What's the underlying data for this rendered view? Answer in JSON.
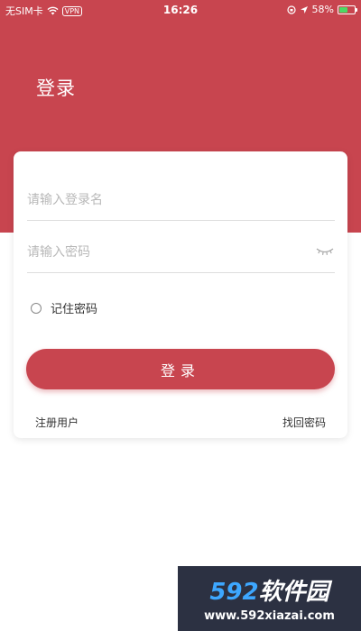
{
  "status_bar": {
    "carrier": "无SIM卡",
    "vpn": "VPN",
    "time": "16:26",
    "battery": "58%",
    "battery_level": 0.58,
    "battery_color": "#4cd964"
  },
  "header": {
    "title": "登录",
    "background_color": "#c8454f"
  },
  "form": {
    "username_placeholder": "请输入登录名",
    "password_placeholder": "请输入密码",
    "password_toggle_icon": "eye-closed-icon",
    "remember_label": "记住密码",
    "remember_checked": false,
    "login_button": "登录",
    "register_link": "注册用户",
    "forgot_link": "找回密码"
  },
  "watermark": {
    "logo_number": "592",
    "logo_text": "软件园",
    "url": "www.592xiazai.com"
  }
}
